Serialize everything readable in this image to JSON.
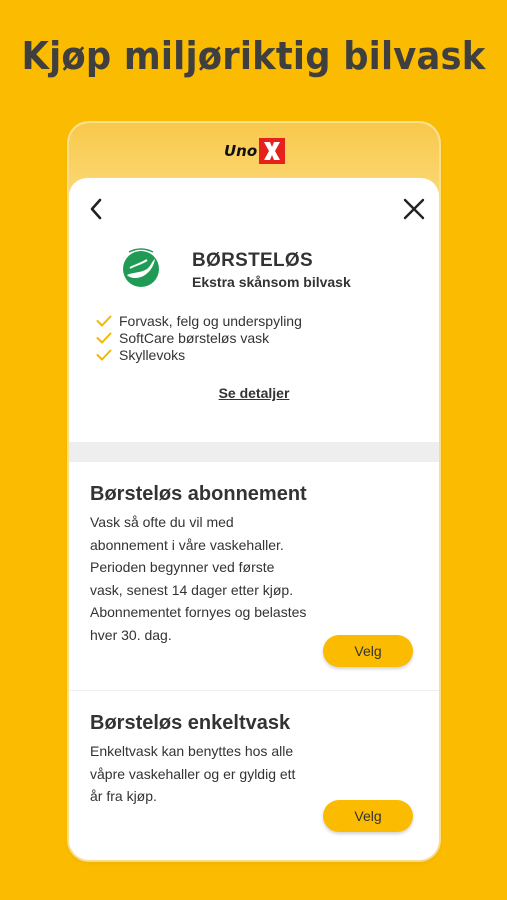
{
  "headline": "Kjøp miljøriktig bilvask",
  "brand": {
    "logo_text": "Uno",
    "accent": "#E4211B"
  },
  "colors": {
    "background": "#FBBB00",
    "button": "#FBBB00",
    "check": "#F2B800"
  },
  "nav": {
    "back_icon": "chevron-left-icon",
    "close_icon": "close-icon"
  },
  "product": {
    "badge_icon": "nordic-swan-ecolabel-icon",
    "title": "BØRSTELØS",
    "subtitle": "Ekstra skånsom bilvask",
    "features": [
      "Forvask, felg og underspyling",
      "SoftCare børsteløs vask",
      "Skyllevoks"
    ],
    "details_link": "Se detaljer"
  },
  "options": [
    {
      "title": "Børsteløs abonnement",
      "description": "Vask så ofte du vil med abonnement i våre vaskehaller. Perioden begynner ved første vask, senest 14 dager etter kjøp. Abonnementet fornyes og belastes hver 30. dag.",
      "button": "Velg"
    },
    {
      "title": "Børsteløs enkeltvask",
      "description": "Enkeltvask kan benyttes hos alle våpre vaskehaller og er gyldig ett år fra kjøp.",
      "button": "Velg"
    }
  ]
}
